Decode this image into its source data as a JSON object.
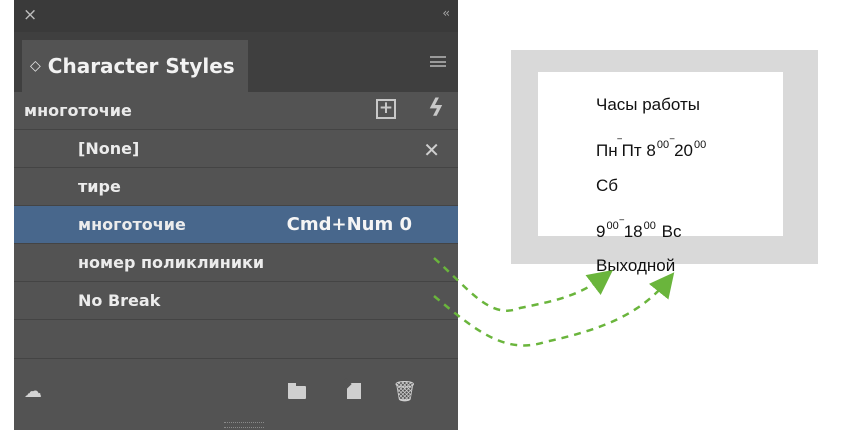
{
  "panel": {
    "close_glyph": "×",
    "collapse_glyph": "‹‹",
    "tab_icon": "◇",
    "title": "Character Styles",
    "group": "многоточие",
    "styles": [
      {
        "label": "[None]",
        "shortcut": "",
        "selected": false,
        "locked": true
      },
      {
        "label": "тире",
        "shortcut": "",
        "selected": false
      },
      {
        "label": "многоточие",
        "shortcut": "Cmd+Num 0",
        "selected": true
      },
      {
        "label": "номер поликлиники",
        "shortcut": "",
        "selected": false
      },
      {
        "label": "No Break",
        "shortcut": "",
        "selected": false
      }
    ],
    "icons": {
      "new_group": "+",
      "quick_apply": "ϟ",
      "no_edit": "✕",
      "cloud": "☁",
      "trash": "🗑"
    }
  },
  "preview": {
    "line1": "Часы работы",
    "line2_pre": "Пн",
    "line2_mid": "Пт",
    "line2_h1": "8",
    "line2_sup1": "00",
    "line2_h2": "20",
    "line2_sup2": "00",
    "line3": "Сб",
    "line4_h1": "9",
    "line4_sup1": "00",
    "line4_h2": "18",
    "line4_sup2": "00",
    "line4_tail": "Вс",
    "line5": "Выходной",
    "dash": "‾"
  },
  "colors": {
    "panel_bg": "#535353",
    "selected_row": "#48678c",
    "arrow": "#6ab53c",
    "preview_frame": "#d9d9d9"
  }
}
